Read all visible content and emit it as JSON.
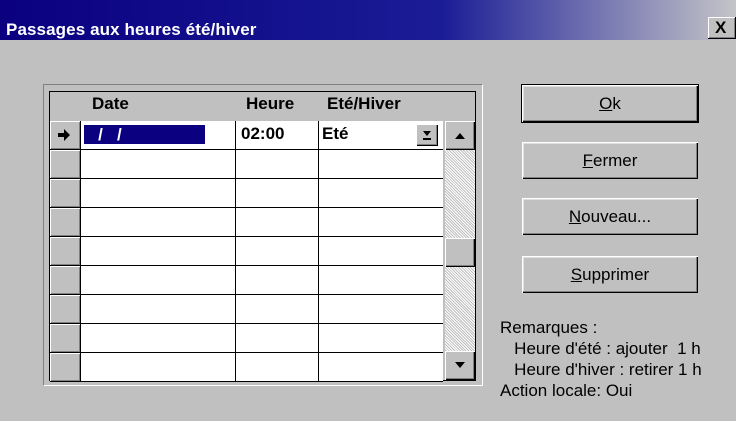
{
  "window": {
    "title": "Passages aux heures été/hiver",
    "close_label": "X"
  },
  "grid": {
    "columns": {
      "date": "Date",
      "heure": "Heure",
      "ete_hiver": "Eté/Hiver"
    },
    "rows": [
      {
        "date": "   /   /",
        "heure": "02:00",
        "ete_hiver": "Eté",
        "current": true
      },
      {
        "date": "",
        "heure": "",
        "ete_hiver": ""
      },
      {
        "date": "",
        "heure": "",
        "ete_hiver": ""
      },
      {
        "date": "",
        "heure": "",
        "ete_hiver": ""
      },
      {
        "date": "",
        "heure": "",
        "ete_hiver": ""
      },
      {
        "date": "",
        "heure": "",
        "ete_hiver": ""
      },
      {
        "date": "",
        "heure": "",
        "ete_hiver": ""
      },
      {
        "date": "",
        "heure": "",
        "ete_hiver": ""
      },
      {
        "date": "",
        "heure": "",
        "ete_hiver": ""
      }
    ],
    "scrollbar_position": 0.5
  },
  "buttons": {
    "ok": {
      "mnemonic": "O",
      "rest": "k"
    },
    "fermer": {
      "mnemonic": "F",
      "rest": "ermer"
    },
    "nouveau": {
      "mnemonic": "N",
      "rest": "ouveau..."
    },
    "supprimer": {
      "mnemonic": "S",
      "rest": "upprimer"
    }
  },
  "remarks": {
    "heading": "Remarques :",
    "line1": "   Heure d'été : ajouter  1 h",
    "line2": "   Heure d'hiver : retirer 1 h",
    "action": "Action locale: Oui"
  },
  "icons": {
    "current_row": "right-arrow-icon",
    "dropdown": "dropdown-arrow-icon",
    "scroll_up": "up-arrow-icon",
    "scroll_down": "down-arrow-icon"
  }
}
